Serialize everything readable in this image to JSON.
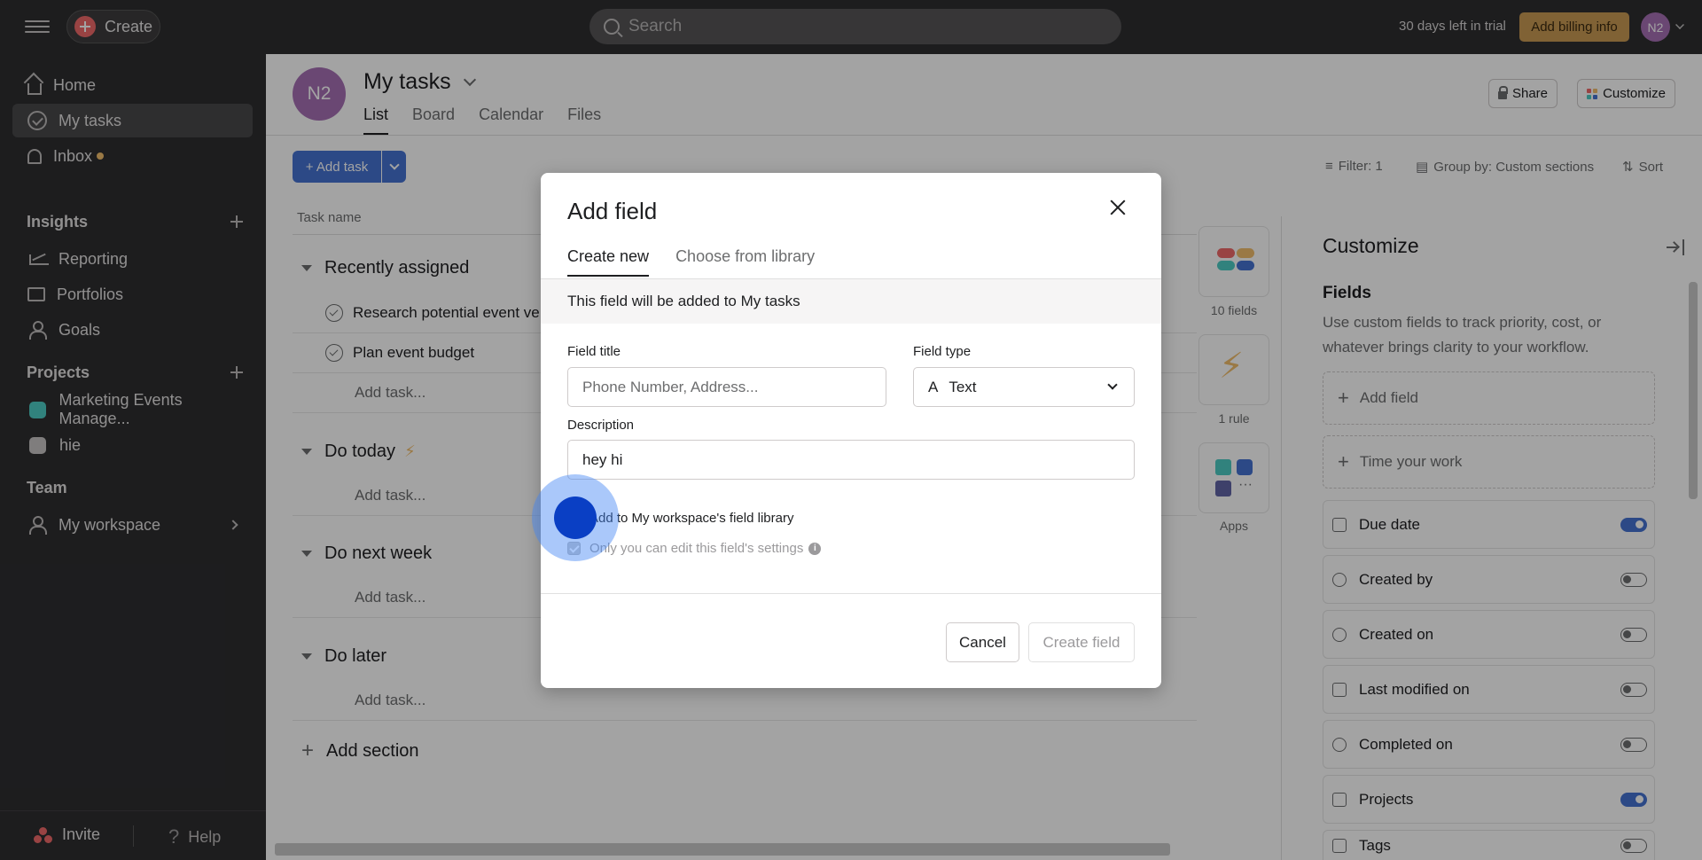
{
  "topbar": {
    "create_label": "Create",
    "search_placeholder": "Search",
    "trial_text": "30 days left in trial",
    "billing_label": "Add billing info",
    "avatar_initials": "N2"
  },
  "sidebar": {
    "nav": [
      {
        "label": "Home"
      },
      {
        "label": "My tasks"
      },
      {
        "label": "Inbox"
      }
    ],
    "insights": {
      "header": "Insights",
      "items": [
        {
          "label": "Reporting"
        },
        {
          "label": "Portfolios"
        },
        {
          "label": "Goals"
        }
      ]
    },
    "projects": {
      "header": "Projects",
      "items": [
        {
          "label": "Marketing Events Manage...",
          "color": "#4ecbc4"
        },
        {
          "label": "hie",
          "color": "#c7c4c4"
        }
      ]
    },
    "team": {
      "header": "Team",
      "items": [
        {
          "label": "My workspace"
        }
      ]
    },
    "invite_label": "Invite",
    "help_label": "Help"
  },
  "main": {
    "avatar_initials": "N2",
    "title": "My tasks",
    "tabs": [
      "List",
      "Board",
      "Calendar",
      "Files"
    ],
    "share_label": "Share",
    "customize_label": "Customize",
    "add_task_label": "+ Add task",
    "filter_label": "Filter: 1",
    "group_label": "Group by: Custom sections",
    "sort_label": "Sort",
    "col_task_name": "Task name",
    "sections": [
      {
        "name": "Recently assigned"
      },
      {
        "name": "Do today"
      },
      {
        "name": "Do next week"
      },
      {
        "name": "Do later"
      }
    ],
    "tasks": [
      "Research potential event ve",
      "Plan event budget"
    ],
    "add_task_row": "Add task...",
    "add_section": "Add section"
  },
  "apps": {
    "fields_label": "10 fields",
    "rules_label": "1 rule",
    "apps_label": "Apps"
  },
  "customize": {
    "title": "Customize",
    "fields_header": "Fields",
    "fields_desc": "Use custom fields to track priority, cost, or whatever brings clarity to your workflow.",
    "add_field": "Add field",
    "time_your_work": "Time your work",
    "fields": [
      {
        "label": "Due date",
        "on": true
      },
      {
        "label": "Created by",
        "on": false
      },
      {
        "label": "Created on",
        "on": false
      },
      {
        "label": "Last modified on",
        "on": false
      },
      {
        "label": "Completed on",
        "on": false
      },
      {
        "label": "Projects",
        "on": true
      },
      {
        "label": "Tags",
        "on": false
      }
    ]
  },
  "modal": {
    "title": "Add field",
    "tabs": [
      "Create new",
      "Choose from library"
    ],
    "banner": "This field will be added to My tasks",
    "field_title_label": "Field title",
    "field_title_placeholder": "Phone Number, Address...",
    "field_type_label": "Field type",
    "field_type_value": "Text",
    "description_label": "Description",
    "description_value": "hey hi",
    "add_to_library": "Add to My workspace's field library",
    "only_you_edit": "Only you can edit this field's settings",
    "cancel_label": "Cancel",
    "create_label": "Create field"
  },
  "colors": {
    "accent": "#4573d2",
    "billing": "#c99a53",
    "avatar": "#a770b5"
  }
}
